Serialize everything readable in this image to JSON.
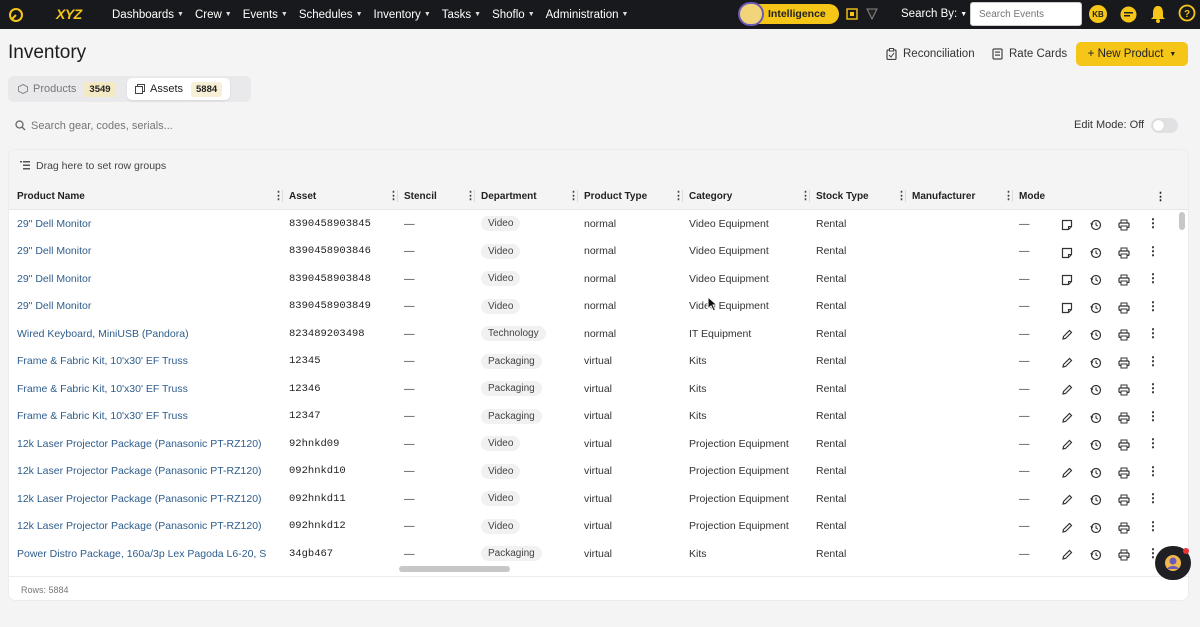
{
  "brand": "XYZ",
  "nav": {
    "items": [
      "Dashboards",
      "Crew",
      "Events",
      "Schedules",
      "Inventory",
      "Tasks",
      "Shoflo",
      "Administration"
    ],
    "intelligence_label": "Intelligence",
    "search_by_label": "Search By:",
    "search_placeholder": "Search Events",
    "avatar_initials": "KB"
  },
  "page": {
    "title": "Inventory",
    "reconciliation_label": "Reconciliation",
    "rate_cards_label": "Rate Cards",
    "new_product_label": "+ New Product"
  },
  "tabs": [
    {
      "label": "Products",
      "count": "3549",
      "active": false
    },
    {
      "label": "Assets",
      "count": "5884",
      "active": true
    }
  ],
  "search": {
    "placeholder": "Search gear, codes, serials..."
  },
  "edit_mode_label": "Edit Mode: Off",
  "grid": {
    "row_group_hint": "Drag here to set row groups",
    "columns": [
      "Product Name",
      "Asset",
      "Stencil",
      "Department",
      "Product Type",
      "Category",
      "Stock Type",
      "Manufacturer",
      "Mode"
    ],
    "rows": [
      {
        "product": "29\" Dell Monitor",
        "asset": "8390458903845",
        "stencil": "—",
        "dept": "Video",
        "type": "normal",
        "category": "Video Equipment",
        "stock": "Rental",
        "mfr": "",
        "mode": "—",
        "action": "note"
      },
      {
        "product": "29\" Dell Monitor",
        "asset": "8390458903846",
        "stencil": "—",
        "dept": "Video",
        "type": "normal",
        "category": "Video Equipment",
        "stock": "Rental",
        "mfr": "",
        "mode": "—",
        "action": "note"
      },
      {
        "product": "29\" Dell Monitor",
        "asset": "8390458903848",
        "stencil": "—",
        "dept": "Video",
        "type": "normal",
        "category": "Video Equipment",
        "stock": "Rental",
        "mfr": "",
        "mode": "—",
        "action": "note"
      },
      {
        "product": "29\" Dell Monitor",
        "asset": "8390458903849",
        "stencil": "—",
        "dept": "Video",
        "type": "normal",
        "category": "Video Equipment",
        "stock": "Rental",
        "mfr": "",
        "mode": "—",
        "action": "note"
      },
      {
        "product": "Wired Keyboard, MiniUSB (Pandora)",
        "asset": "823489203498",
        "stencil": "—",
        "dept": "Technology",
        "type": "normal",
        "category": "IT Equipment",
        "stock": "Rental",
        "mfr": "",
        "mode": "—",
        "action": "pencil"
      },
      {
        "product": "Frame & Fabric Kit, 10'x30' EF Truss",
        "asset": "12345",
        "stencil": "—",
        "dept": "Packaging",
        "type": "virtual",
        "category": "Kits",
        "stock": "Rental",
        "mfr": "",
        "mode": "—",
        "action": "pencil"
      },
      {
        "product": "Frame & Fabric Kit, 10'x30' EF Truss",
        "asset": "12346",
        "stencil": "—",
        "dept": "Packaging",
        "type": "virtual",
        "category": "Kits",
        "stock": "Rental",
        "mfr": "",
        "mode": "—",
        "action": "pencil"
      },
      {
        "product": "Frame & Fabric Kit, 10'x30' EF Truss",
        "asset": "12347",
        "stencil": "—",
        "dept": "Packaging",
        "type": "virtual",
        "category": "Kits",
        "stock": "Rental",
        "mfr": "",
        "mode": "—",
        "action": "pencil"
      },
      {
        "product": "12k Laser Projector Package (Panasonic PT-RZ120)",
        "asset": "92hnkd09",
        "stencil": "—",
        "dept": "Video",
        "type": "virtual",
        "category": "Projection Equipment",
        "stock": "Rental",
        "mfr": "",
        "mode": "—",
        "action": "pencil"
      },
      {
        "product": "12k Laser Projector Package (Panasonic PT-RZ120)",
        "asset": "092hnkd10",
        "stencil": "—",
        "dept": "Video",
        "type": "virtual",
        "category": "Projection Equipment",
        "stock": "Rental",
        "mfr": "",
        "mode": "—",
        "action": "pencil"
      },
      {
        "product": "12k Laser Projector Package (Panasonic PT-RZ120)",
        "asset": "092hnkd11",
        "stencil": "—",
        "dept": "Video",
        "type": "virtual",
        "category": "Projection Equipment",
        "stock": "Rental",
        "mfr": "",
        "mode": "—",
        "action": "pencil"
      },
      {
        "product": "12k Laser Projector Package (Panasonic PT-RZ120)",
        "asset": "092hnkd12",
        "stencil": "—",
        "dept": "Video",
        "type": "virtual",
        "category": "Projection Equipment",
        "stock": "Rental",
        "mfr": "",
        "mode": "—",
        "action": "pencil"
      },
      {
        "product": "Power Distro Package, 160a/3p Lex Pagoda L6-20, S",
        "asset": "34gb467",
        "stencil": "—",
        "dept": "Packaging",
        "type": "virtual",
        "category": "Kits",
        "stock": "Rental",
        "mfr": "",
        "mode": "—",
        "action": "pencil"
      }
    ],
    "rows_label": "Rows: 5884"
  },
  "colors": {
    "accent": "#f5c518",
    "nav_bg": "#17191c",
    "link": "#2e5d8c"
  }
}
